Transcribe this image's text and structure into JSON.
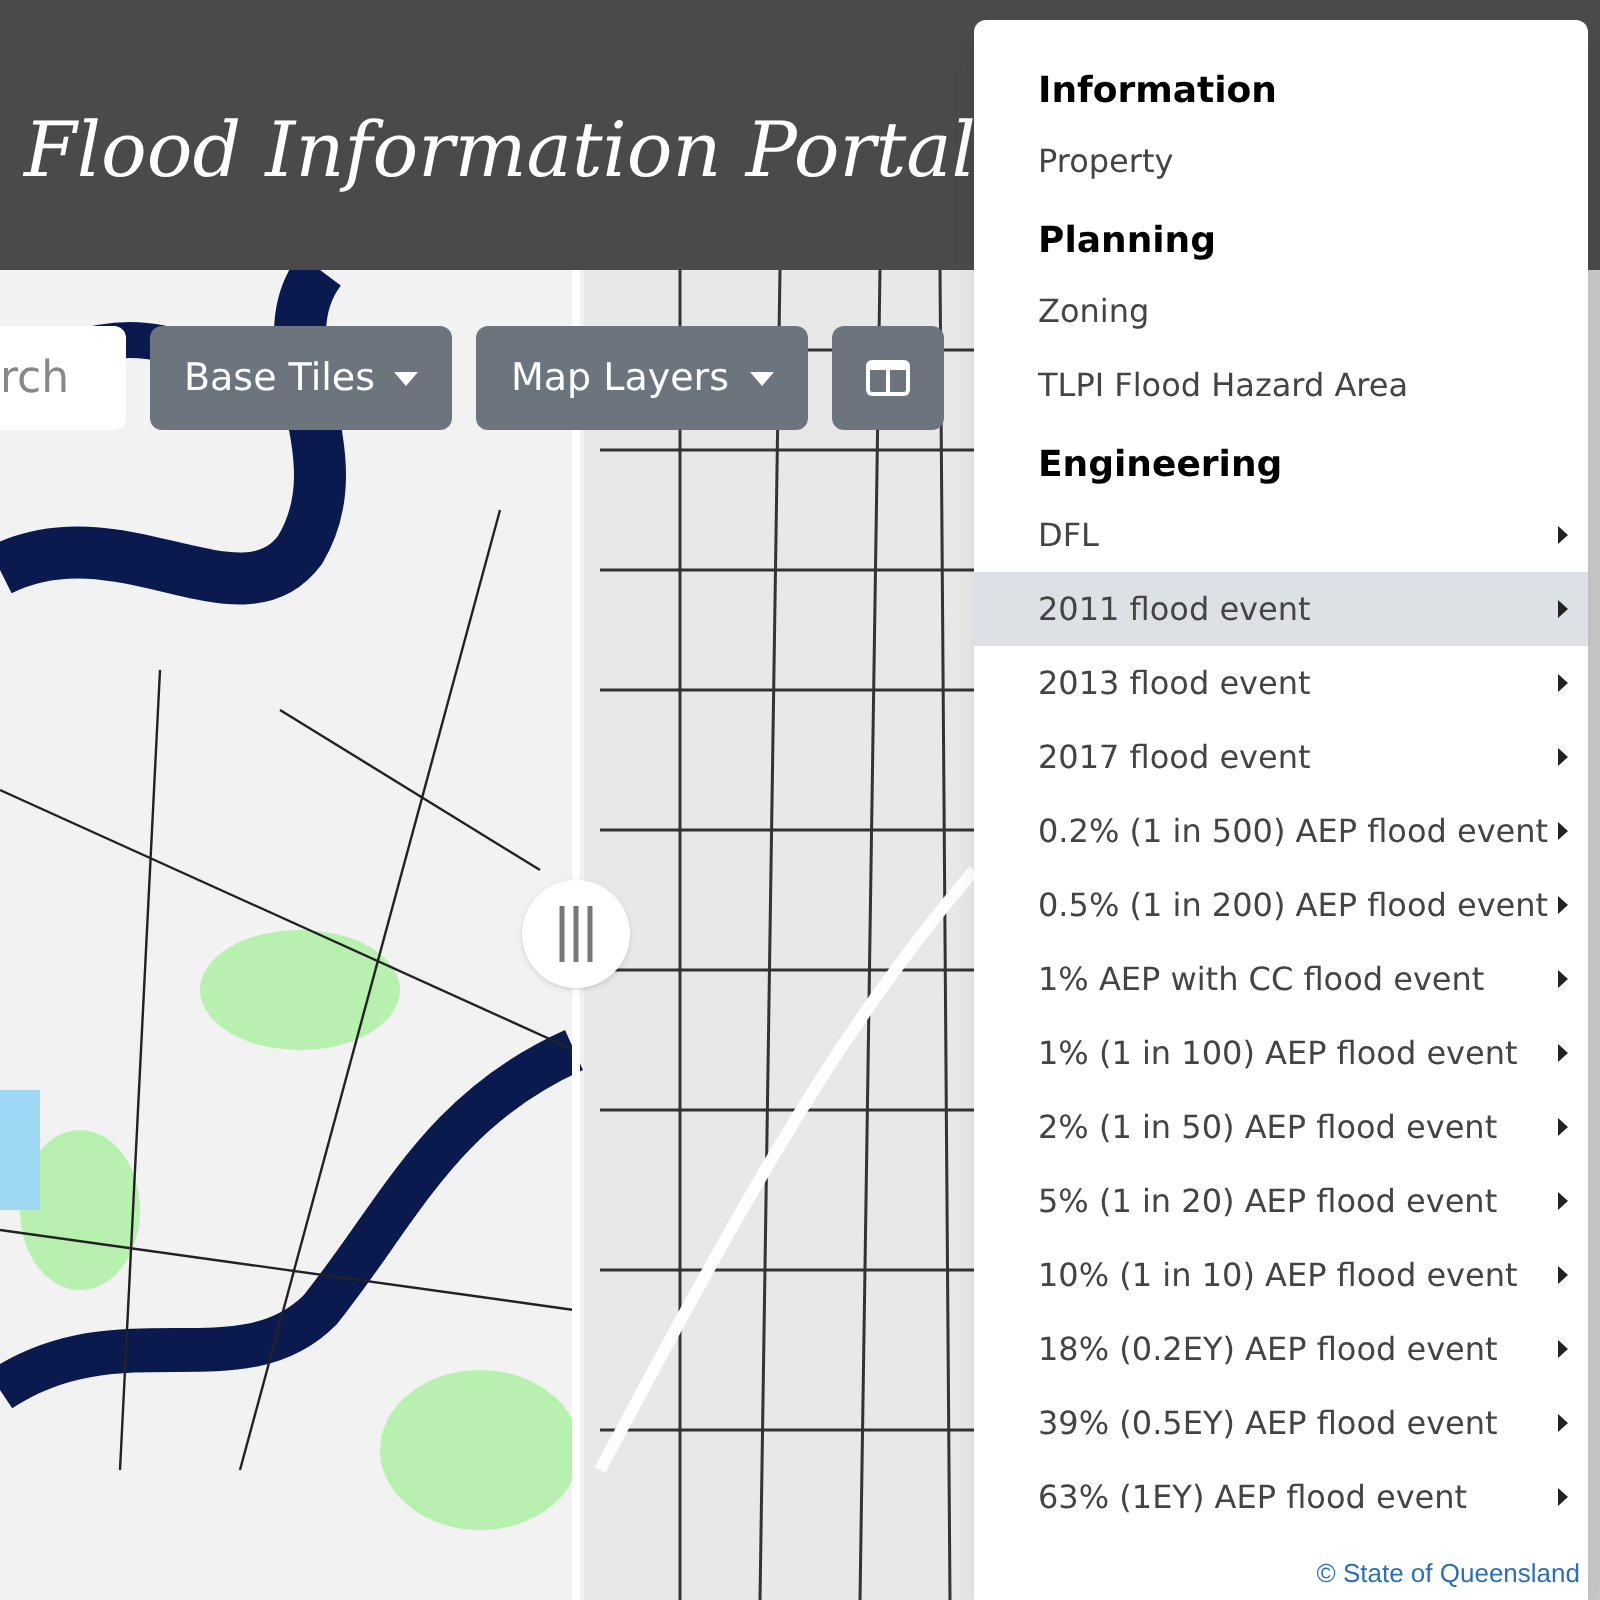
{
  "header": {
    "title": "Flood Information Portal"
  },
  "toolbar": {
    "search": {
      "placeholder": "rch"
    },
    "buttons": [
      {
        "kind": "dropdown",
        "label": "Base Tiles"
      },
      {
        "kind": "dropdown",
        "label": "Map Layers"
      },
      {
        "kind": "icon"
      }
    ]
  },
  "menu": {
    "items": [
      {
        "kind": "header",
        "label": "Information"
      },
      {
        "kind": "item",
        "label": "Property",
        "submenu": false,
        "selected": false
      },
      {
        "kind": "header",
        "label": "Planning"
      },
      {
        "kind": "item",
        "label": "Zoning",
        "submenu": false,
        "selected": false
      },
      {
        "kind": "item",
        "label": "TLPI Flood Hazard Area",
        "submenu": false,
        "selected": false
      },
      {
        "kind": "header",
        "label": "Engineering"
      },
      {
        "kind": "item",
        "label": "DFL",
        "submenu": true,
        "selected": false
      },
      {
        "kind": "item",
        "label": "2011 flood event",
        "submenu": true,
        "selected": true
      },
      {
        "kind": "item",
        "label": "2013 flood event",
        "submenu": true,
        "selected": false
      },
      {
        "kind": "item",
        "label": "2017 flood event",
        "submenu": true,
        "selected": false
      },
      {
        "kind": "item",
        "label": "0.2% (1 in 500) AEP flood event",
        "submenu": true,
        "selected": false
      },
      {
        "kind": "item",
        "label": "0.5% (1 in 200) AEP flood event",
        "submenu": true,
        "selected": false
      },
      {
        "kind": "item",
        "label": "1% AEP with CC flood event",
        "submenu": true,
        "selected": false
      },
      {
        "kind": "item",
        "label": "1% (1 in 100) AEP flood event",
        "submenu": true,
        "selected": false
      },
      {
        "kind": "item",
        "label": "2% (1 in 50) AEP flood event",
        "submenu": true,
        "selected": false
      },
      {
        "kind": "item",
        "label": "5% (1 in 20) AEP flood event",
        "submenu": true,
        "selected": false
      },
      {
        "kind": "item",
        "label": "10% (1 in 10) AEP flood event",
        "submenu": true,
        "selected": false
      },
      {
        "kind": "item",
        "label": "18% (0.2EY) AEP flood event",
        "submenu": true,
        "selected": false
      },
      {
        "kind": "item",
        "label": "39% (0.5EY) AEP flood event",
        "submenu": true,
        "selected": false
      },
      {
        "kind": "item",
        "label": "63% (1EY) AEP flood event",
        "submenu": true,
        "selected": false
      }
    ]
  },
  "attribution": "© State of Queensland"
}
